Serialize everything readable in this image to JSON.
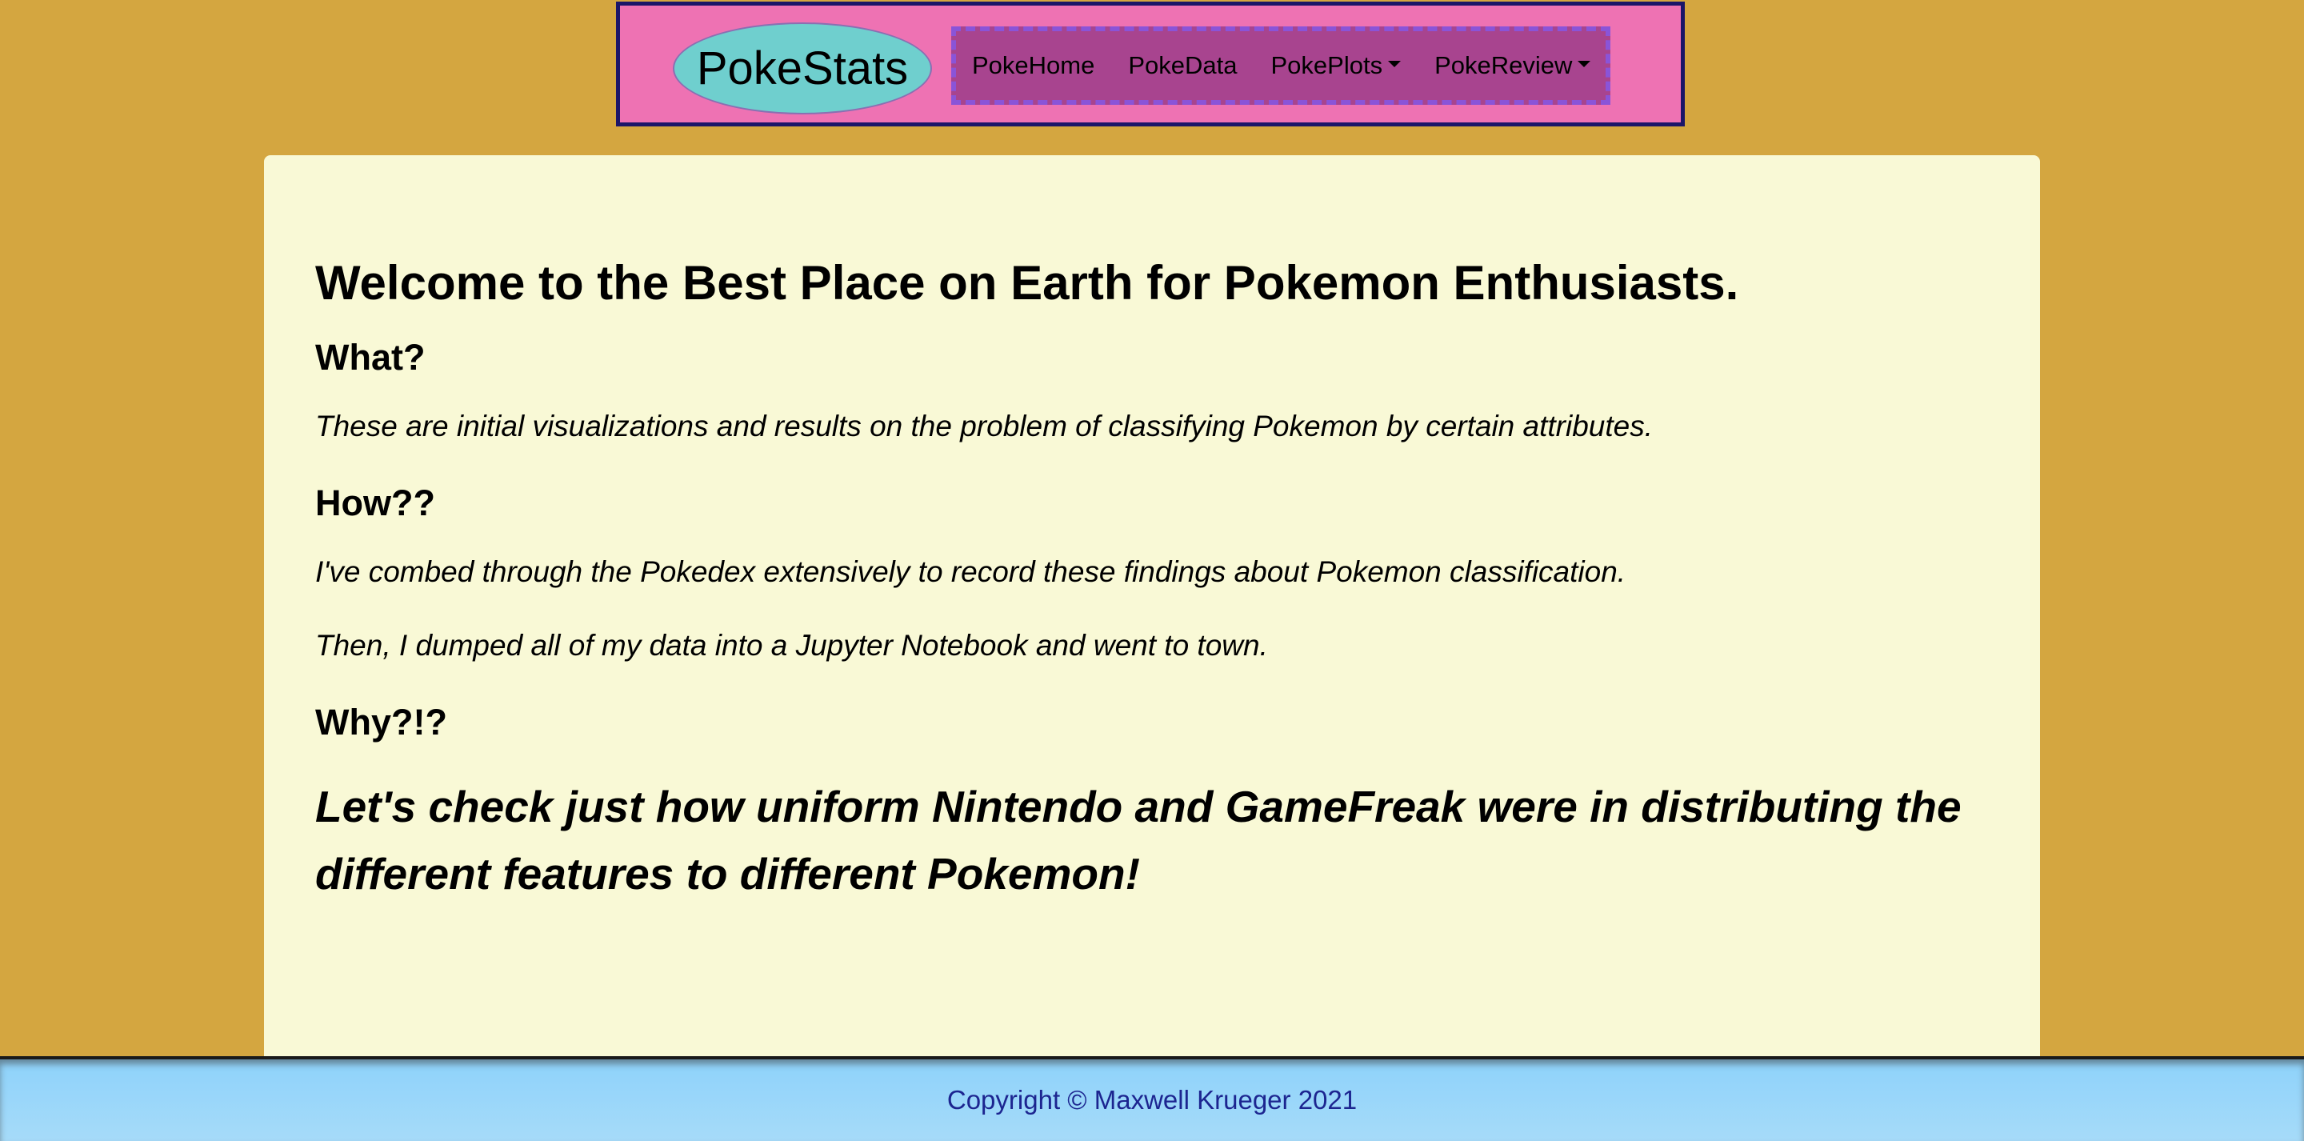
{
  "navbar": {
    "brand": "PokeStats",
    "links": [
      {
        "label": "PokeHome",
        "dropdown": false
      },
      {
        "label": "PokeData",
        "dropdown": false
      },
      {
        "label": "PokePlots",
        "dropdown": true
      },
      {
        "label": "PokeReview",
        "dropdown": true
      }
    ]
  },
  "main": {
    "title": "Welcome to the Best Place on Earth for Pokemon Enthusiasts.",
    "what_heading": "What?",
    "what_text": "These are initial visualizations and results on the problem of classifying Pokemon by certain attributes.",
    "how_heading": "How??",
    "how_text_1": "I've combed through the Pokedex extensively to record these findings about Pokemon classification.",
    "how_text_2": "Then, I dumped all of my data into a Jupyter Notebook and went to town.",
    "why_heading": "Why?!?",
    "why_text": "Let's check just how uniform Nintendo and GameFreak were in distributing the different features to different Pokemon!"
  },
  "footer": {
    "copyright": "Copyright © Maxwell Krueger 2021"
  },
  "colors": {
    "page_background": "#d4a640",
    "navbar_background": "#ee72b3",
    "navbar_border": "#1b1568",
    "brand_background": "#6fcfce",
    "menu_background": "#a8448f",
    "menu_border": "#8a54d8",
    "content_background": "#f9f9d6",
    "footer_background": "#8ed2fa",
    "footer_text": "#1c2590"
  }
}
